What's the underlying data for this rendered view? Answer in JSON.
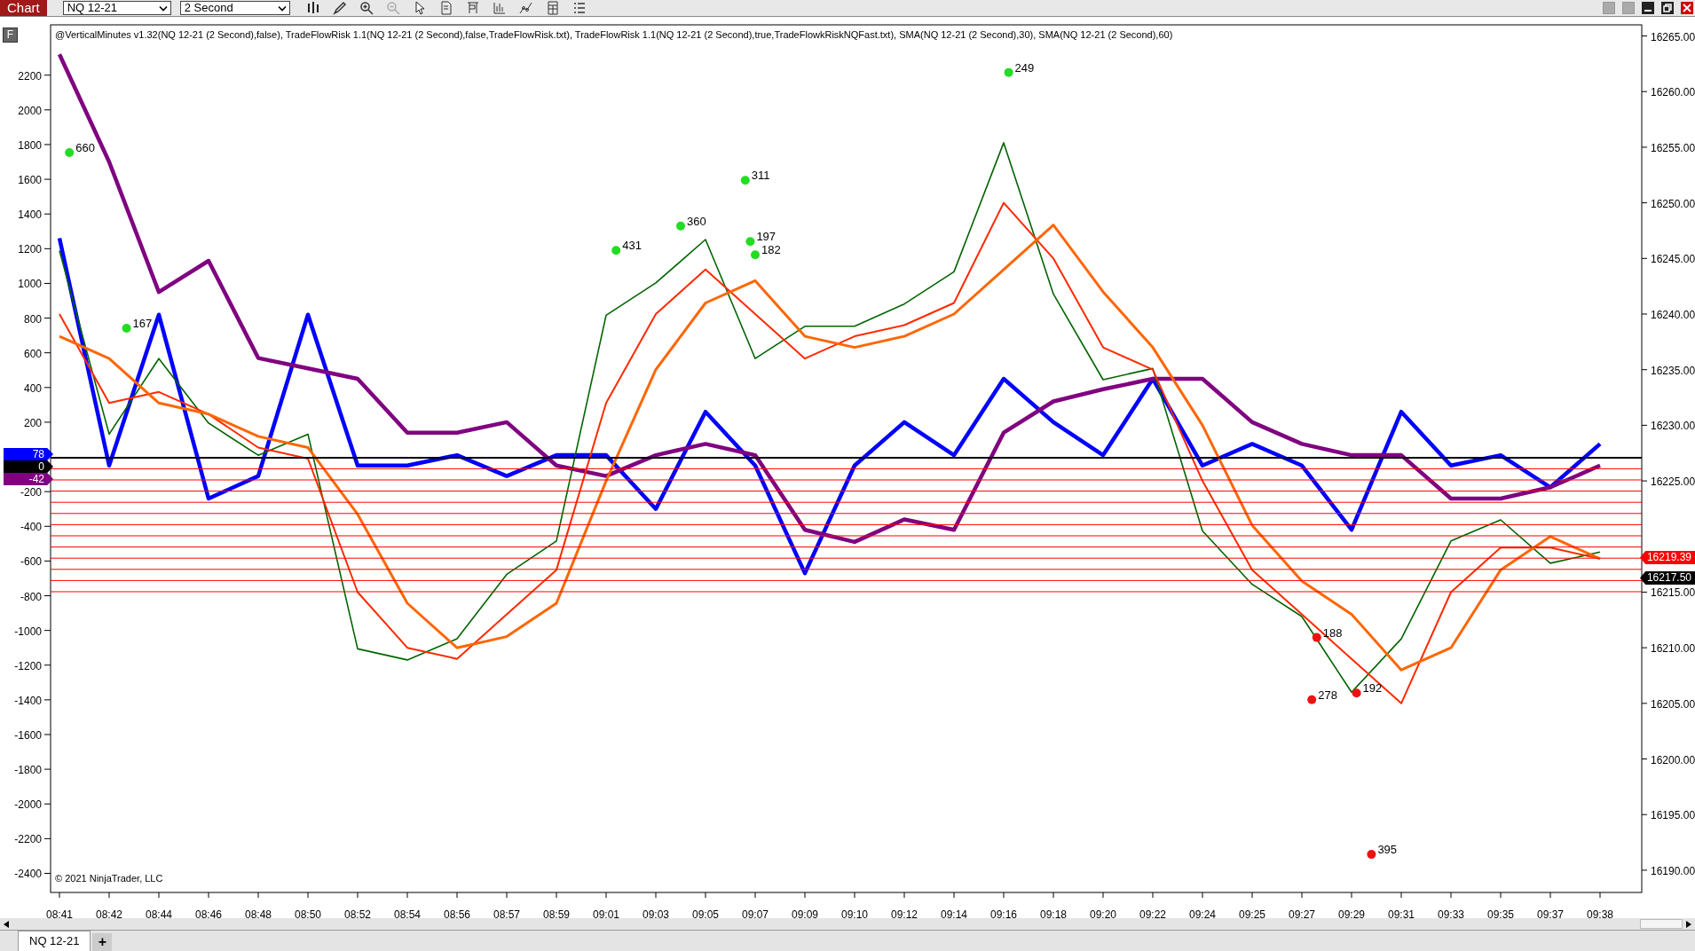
{
  "toolbar": {
    "title": "Chart",
    "instrument": "NQ 12-21",
    "interval": "2 Second"
  },
  "panel_button": "F",
  "indicator_label": "@VerticalMinutes v1.32(NQ 12-21 (2 Second),false), TradeFlowRisk 1.1(NQ 12-21 (2 Second),false,TradeFlowRisk.txt), TradeFlowRisk 1.1(NQ 12-21 (2 Second),true,TradeFlowkRiskNQFast.txt), SMA(NQ 12-21 (2 Second),30), SMA(NQ 12-21 (2 Second),60)",
  "copyright": "© 2021 NinjaTrader, LLC",
  "left_markers": [
    {
      "text": "78",
      "color": "#0000ff"
    },
    {
      "text": "0",
      "color": "#000000"
    },
    {
      "text": "-42",
      "color": "#800080"
    }
  ],
  "right_markers": [
    {
      "text": "16219.39",
      "color": "#ff0000"
    },
    {
      "text": "16217.50",
      "color": "#000000"
    }
  ],
  "price_chart": {
    "chart_data": {
      "type": "line",
      "categories": [
        "08:41",
        "08:42",
        "08:44",
        "08:46",
        "08:48",
        "08:50",
        "08:52",
        "08:54",
        "08:56",
        "08:57",
        "08:59",
        "09:01",
        "09:03",
        "09:05",
        "09:07",
        "09:09",
        "09:10",
        "09:12",
        "09:14",
        "09:16",
        "09:18",
        "09:20",
        "09:22",
        "09:24",
        "09:25",
        "09:27",
        "09:29",
        "09:31",
        "09:33",
        "09:35",
        "09:37",
        "09:38"
      ],
      "series": [
        {
          "color": "#006400",
          "values": [
            16245.7,
            16229.2,
            16236,
            16230.2,
            16227.3,
            16229.2,
            16209.9,
            16208.9,
            16210.8,
            16216.6,
            16219.6,
            16239.9,
            16242.8,
            16246.7,
            16236,
            16238.9,
            16238.9,
            16240.9,
            16243.8,
            16255.4,
            16241.8,
            16234.1,
            16235.1,
            16220.5,
            16215.7,
            16212.8,
            16206,
            16210.8,
            16219.6,
            16221.5,
            16217.6,
            16218.6
          ]
        },
        {
          "color": "#ff2a00",
          "values": [
            16240,
            16232,
            16233,
            16231,
            16228,
            16227,
            16215,
            16210,
            16209,
            16213,
            16217,
            16232,
            16240,
            16244,
            16240,
            16236,
            16238,
            16239,
            16241,
            16250,
            16245,
            16237,
            16235,
            16225,
            16217,
            16213,
            16209,
            16205,
            16215,
            16219,
            16219,
            16218
          ]
        },
        {
          "color": "#ff6600",
          "values": [
            16238,
            16236,
            16232,
            16231,
            16229,
            16228,
            16222,
            16214,
            16210,
            16211,
            16214,
            16225,
            16235,
            16241,
            16243,
            16238,
            16237,
            16238,
            16240,
            16244,
            16248,
            16242,
            16237,
            16230,
            16221,
            16216,
            16213,
            16208,
            16210,
            16217,
            16220,
            16218
          ]
        }
      ],
      "ylim": [
        16188,
        16266
      ],
      "yticks": [
        {
          "value": 16265,
          "label": "16265.00"
        },
        {
          "value": 16260,
          "label": "16260.00"
        },
        {
          "value": 16255,
          "label": "16255.00"
        },
        {
          "value": 16250,
          "label": "16250.00"
        },
        {
          "value": 16245,
          "label": "16245.00"
        },
        {
          "value": 16240,
          "label": "16240.00"
        },
        {
          "value": 16235,
          "label": "16235.00"
        },
        {
          "value": 16230,
          "label": "16230.00"
        },
        {
          "value": 16225,
          "label": "16225.00"
        },
        {
          "value": 16215,
          "label": "16215.00"
        },
        {
          "value": 16210,
          "label": "16210.00"
        },
        {
          "value": 16205,
          "label": "16205.00"
        },
        {
          "value": 16200,
          "label": "16200.00"
        },
        {
          "value": 16195,
          "label": "16195.00"
        },
        {
          "value": 16190,
          "label": "16190.00"
        }
      ]
    }
  },
  "trade_labels": [
    {
      "text": "249",
      "kind": "buy"
    },
    {
      "text": "660",
      "kind": "buy"
    },
    {
      "text": "167",
      "kind": "buy"
    },
    {
      "text": "431",
      "kind": "buy"
    },
    {
      "text": "311",
      "kind": "buy"
    },
    {
      "text": "360",
      "kind": "buy"
    },
    {
      "text": "197",
      "kind": "buy"
    },
    {
      "text": "182",
      "kind": "buy"
    },
    {
      "text": "188",
      "kind": "sell"
    },
    {
      "text": "278",
      "kind": "sell"
    },
    {
      "text": "192",
      "kind": "sell"
    },
    {
      "text": "395",
      "kind": "sell"
    }
  ],
  "indicator_chart": {
    "chart_data": {
      "type": "line",
      "series": [
        {
          "color": "#0000ff",
          "values": [
            1260,
            -50,
            820,
            -240,
            -110,
            820,
            -50,
            -50,
            10,
            -110,
            10,
            10,
            -300,
            260,
            -50,
            -670,
            -50,
            200,
            10,
            450,
            200,
            10,
            450,
            -50,
            75,
            -50,
            -420,
            260,
            -50,
            10,
            -175,
            75
          ]
        },
        {
          "color": "#800080",
          "values": [
            2320,
            1700,
            950,
            1130,
            570,
            510,
            450,
            140,
            140,
            200,
            -50,
            -110,
            10,
            75,
            10,
            -420,
            -490,
            -360,
            -420,
            140,
            320,
            390,
            450,
            450,
            200,
            75,
            10,
            10,
            -240,
            -240,
            -175,
            -50
          ]
        }
      ],
      "ylim": [
        -2510,
        2490
      ],
      "yticks": [
        2200,
        2000,
        1800,
        1600,
        1400,
        1200,
        1000,
        800,
        600,
        400,
        200,
        -200,
        -400,
        -600,
        -800,
        -1000,
        -1200,
        -1400,
        -1600,
        -1800,
        -2000,
        -2200,
        -2400
      ]
    }
  },
  "tabs": [
    {
      "label": "NQ 12-21",
      "selected": true
    }
  ],
  "add_tab": "+"
}
